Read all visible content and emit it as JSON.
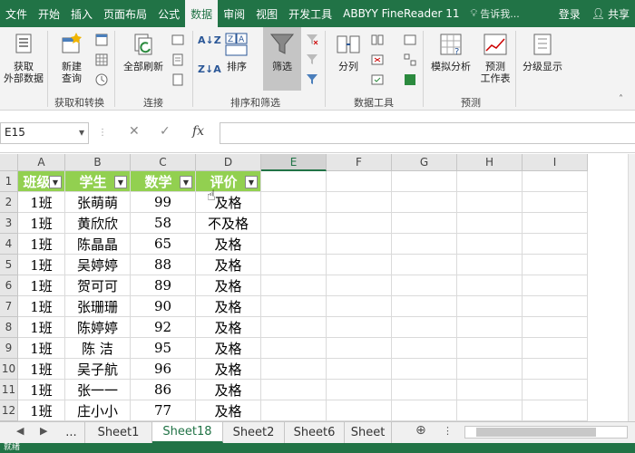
{
  "ribbon_tabs": [
    "文件",
    "开始",
    "插入",
    "页面布局",
    "公式",
    "数据",
    "审阅",
    "视图",
    "开发工具",
    "ABBYY FineReader 11"
  ],
  "active_tab_index": 5,
  "tell_me": "告诉我...",
  "login": "登录",
  "share": "共享",
  "ribbon": {
    "get_external": "获取\n外部数据",
    "new_query": "新建\n查询",
    "refresh_all": "全部刷新",
    "sort": "排序",
    "filter": "筛选",
    "split": "分列",
    "what_if": "模拟分析",
    "forecast": "预测\n工作表",
    "outline": "分级显示",
    "groups": {
      "get_transform": "获取和转换",
      "connections": "连接",
      "sort_filter": "排序和筛选",
      "data_tools": "数据工具",
      "forecast": "预测"
    }
  },
  "name_box": "E15",
  "fx_label": "fx",
  "columns": [
    "A",
    "B",
    "C",
    "D",
    "E",
    "F",
    "G",
    "H",
    "I"
  ],
  "selected_column": "E",
  "row_numbers": [
    "1",
    "2",
    "3",
    "4",
    "5",
    "6",
    "7",
    "8",
    "9",
    "10",
    "11",
    "12"
  ],
  "headers": [
    "班级",
    "学生",
    "数学",
    "评价"
  ],
  "rows": [
    [
      "1班",
      "张萌萌",
      "99",
      "及格"
    ],
    [
      "1班",
      "黄欣欣",
      "58",
      "不及格"
    ],
    [
      "1班",
      "陈晶晶",
      "65",
      "及格"
    ],
    [
      "1班",
      "吴婷婷",
      "88",
      "及格"
    ],
    [
      "1班",
      "贺可可",
      "89",
      "及格"
    ],
    [
      "1班",
      "张珊珊",
      "90",
      "及格"
    ],
    [
      "1班",
      "陈婷婷",
      "92",
      "及格"
    ],
    [
      "1班",
      "陈 洁",
      "95",
      "及格"
    ],
    [
      "1班",
      "吴子航",
      "96",
      "及格"
    ],
    [
      "1班",
      "张一一",
      "86",
      "及格"
    ],
    [
      "1班",
      "庄小小",
      "77",
      "及格"
    ]
  ],
  "sheets": [
    "...",
    "Sheet1",
    "Sheet18",
    "Sheet2",
    "Sheet6",
    "Sheet"
  ],
  "active_sheet": "Sheet18",
  "status_text": "就绪",
  "colors": {
    "excel_green": "#217346",
    "header_fill": "#92d050"
  }
}
